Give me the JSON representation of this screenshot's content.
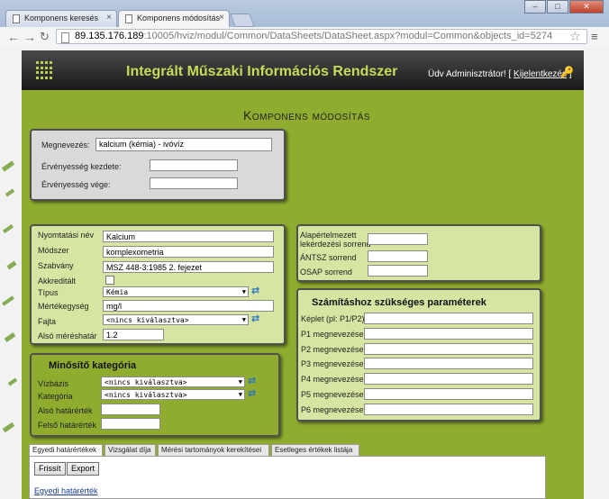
{
  "browser": {
    "tabs": [
      {
        "label": "Komponens keresés"
      },
      {
        "label": "Komponens módosítás"
      }
    ],
    "url_host": "89.135.176.189",
    "url_rest": ":10005/hviz/modul/Common/DataSheets/DataSheet.aspx?modul=Common&objects_id=5274"
  },
  "header": {
    "app_title": "Integrált Műszaki Információs Rendszer",
    "welcome": "Üdv Adminisztrátor! [",
    "logout": "Kijelentkezés",
    "welcome_end": "]"
  },
  "page_title": "Komponens módosítás",
  "main_box": {
    "name_label": "Megnevezés:",
    "name_value": "kalcium (kémia) - ivóvíz",
    "valid_from_label": "Érvényesség kezdete:",
    "valid_from_value": "",
    "valid_to_label": "Érvényesség vége:",
    "valid_to_value": ""
  },
  "details": {
    "print_name_label": "Nyomtatási név",
    "print_name_value": "Kalcium",
    "method_label": "Módszer",
    "method_value": "komplexometria",
    "standard_label": "Szabvány",
    "standard_value": "MSZ 448-3:1985 2. fejezet",
    "accredited_label": "Akkreditált",
    "type_label": "Típus",
    "type_value": "Kémia",
    "unit_label": "Mértékegység",
    "unit_value": "mg/l",
    "kind_label": "Fajta",
    "kind_value": "<nincs kiválasztva>",
    "lower_limit_label": "Alsó méréshatár",
    "lower_limit_value": "1.2"
  },
  "qualifier": {
    "title": "Minősítő kategória",
    "water_base_label": "Vízbázis",
    "water_base_value": "<nincs kiválasztva>",
    "category_label": "Kategória",
    "category_value": "<nincs kiválasztva>",
    "lower_label": "Alsó határérték",
    "lower_value": "",
    "upper_label": "Felső határérték",
    "upper_value": ""
  },
  "order_box": {
    "default_order_label_1": "Alapértelmezett",
    "default_order_label_2": "lekérdezési sorrend",
    "default_order_value": "",
    "antsz_label": "ÁNTSZ sorrend",
    "antsz_value": "",
    "osap_label": "OSAP sorrend",
    "osap_value": ""
  },
  "params": {
    "title": "Számításhoz szükséges paraméterek",
    "rows": [
      {
        "label": "Képlet (pl: P1/P2)",
        "value": ""
      },
      {
        "label": "P1 megnevezése",
        "value": ""
      },
      {
        "label": "P2 megnevezése",
        "value": ""
      },
      {
        "label": "P3 megnevezése",
        "value": ""
      },
      {
        "label": "P4 megnevezése",
        "value": ""
      },
      {
        "label": "P5 megnevezése",
        "value": ""
      },
      {
        "label": "P6 megnevezése",
        "value": ""
      }
    ]
  },
  "bottom_tabs": [
    {
      "label": "Egyedi határértékek"
    },
    {
      "label": "Vizsgálat díja"
    },
    {
      "label": "Mérési tartományok kerekítései"
    },
    {
      "label": "Esetleges értékek listája"
    }
  ],
  "panel": {
    "refresh_button": "Frissít",
    "export_button": "Export",
    "section_link": "Egyedi határérték"
  },
  "colors": {
    "frame_green": "#8fac2f",
    "box_green": "#d6e6a2",
    "title_green": "#c4dc5a"
  }
}
